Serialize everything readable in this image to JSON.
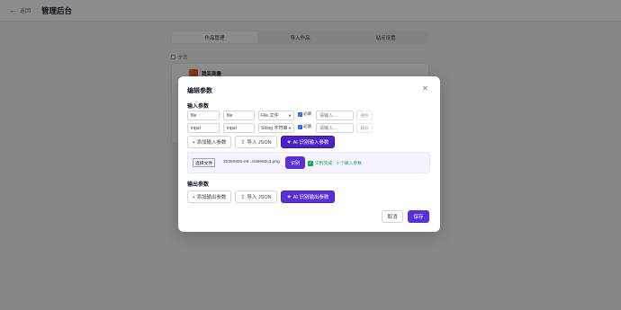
{
  "topbar": {
    "back_label": "返回",
    "title": "管理后台"
  },
  "tabs": [
    {
      "label": "作品管理",
      "active": true
    },
    {
      "label": "导入作品",
      "active": false
    },
    {
      "label": "站点设置",
      "active": false
    }
  ],
  "background": {
    "select_all_label": "全选",
    "card_title": "我买到最"
  },
  "modal": {
    "title": "编辑参数",
    "input_section_title": "输入参数",
    "input_rows": [
      {
        "name": "file",
        "label": "file",
        "type": "File 文件",
        "required_label": "必填",
        "required": true,
        "desc_placeholder": "请输入...",
        "delete_label": "删除"
      },
      {
        "name": "input",
        "label": "input",
        "type": "String 字符串",
        "required_label": "必填",
        "required": true,
        "desc_placeholder": "请输入...",
        "delete_label": "删除"
      }
    ],
    "input_buttons": {
      "add": "+ 添加输入参数",
      "import": "导入 JSON",
      "ai": "AI 识别输入参数"
    },
    "upload": {
      "choose_file_label": "选择文件",
      "file_name": "20250831-e9...636960cd.png",
      "recognize_label": "识别",
      "status_text": "识别完成：2 个输入参数"
    },
    "output_section_title": "输出参数",
    "output_buttons": {
      "add": "+ 添加输出参数",
      "import": "导入 JSON",
      "ai": "AI 识别输出参数"
    },
    "footer": {
      "cancel": "取消",
      "save": "保存"
    }
  },
  "colors": {
    "accent": "#5b2fd6",
    "success": "#16a34a",
    "overlay": "rgba(0,0,0,0.45)"
  },
  "icons": {
    "back": "arrow-left-icon",
    "close": "close-icon",
    "import": "upload-icon",
    "ai": "ai-sparkle-icon",
    "success": "check-icon"
  }
}
